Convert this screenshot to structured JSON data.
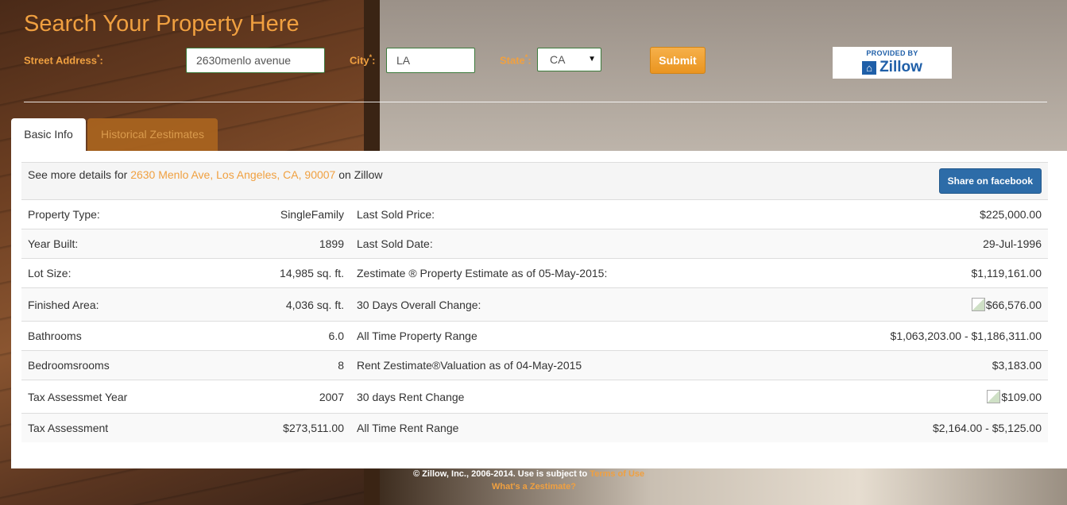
{
  "header": {
    "title": "Search Your Property Here",
    "street_label": "Street Address",
    "city_label": "City",
    "state_label": "State",
    "required_mark": "*",
    "label_suffix": ":",
    "street_value": "2630menlo avenue",
    "city_value": "LA",
    "state_value": "CA",
    "submit_label": "Submit",
    "provider_label": "PROVIDED BY",
    "provider_brand": "Zillow"
  },
  "tabs": [
    {
      "label": "Basic Info",
      "active": true
    },
    {
      "label": "Historical Zestimates",
      "active": false
    }
  ],
  "details": {
    "prefix": "See more details for",
    "address": "2630 Menlo Ave, Los Angeles, CA, 90007",
    "suffix": "on Zillow",
    "share_label": "Share on facebook"
  },
  "rows": [
    {
      "l_label": "Property Type:",
      "l_value": "SingleFamily",
      "r_label": "Last Sold Price:",
      "r_value": "$225,000.00"
    },
    {
      "l_label": "Year Built:",
      "l_value": "1899",
      "r_label": "Last Sold Date:",
      "r_value": "29-Jul-1996"
    },
    {
      "l_label": "Lot Size:",
      "l_value": "14,985 sq. ft.",
      "r_label": "Zestimate ® Property Estimate as of 05-May-2015:",
      "r_value": "$1,119,161.00"
    },
    {
      "l_label": "Finished Area:",
      "l_value": "4,036 sq. ft.",
      "r_label": "30 Days Overall Change:",
      "r_value": "$66,576.00"
    },
    {
      "l_label": "Bathrooms",
      "l_value": "6.0",
      "r_label": "All Time Property Range",
      "r_value": "$1,063,203.00 - $1,186,311.00"
    },
    {
      "l_label": "Bedroomsrooms",
      "l_value": "8",
      "r_label": "Rent Zestimate®Valuation as of 04-May-2015",
      "r_value": "$3,183.00"
    },
    {
      "l_label": "Tax Assessmet Year",
      "l_value": "2007",
      "r_label": "30 days Rent Change",
      "r_value": "$109.00"
    },
    {
      "l_label": "Tax Assessment",
      "l_value": "$273,511.00",
      "r_label": "All Time Rent Range",
      "r_value": "$2,164.00 - $5,125.00"
    }
  ],
  "footer": {
    "copyright": "© Zillow, Inc., 2006-2014. Use is subject to",
    "terms_link": "Terms of Use",
    "whats_link": "What's a Zestimate?"
  }
}
